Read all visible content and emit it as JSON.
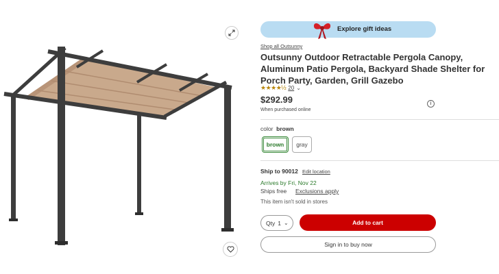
{
  "gallery": {
    "expand_icon": "expand-icon",
    "favorite_icon": "heart-icon",
    "canopy_color": "#c9a98c",
    "frame_color": "#3d3d3d"
  },
  "promo": {
    "label": "Explore gift ideas",
    "icon": "gift-bow-icon",
    "bg_color": "#b9dcf2"
  },
  "product": {
    "shop_all": "Shop all Outsunny",
    "title": "Outsunny Outdoor Retractable Pergola Canopy, Aluminum Patio Pergola, Backyard Shade Shelter for Porch Party, Garden, Grill Gazebo",
    "rating_stars": "★★★★½",
    "rating_count": "20",
    "price": "$292.99",
    "price_note": "When purchased online"
  },
  "variant": {
    "color_label": "color",
    "color_value": "brown",
    "options": [
      "brown",
      "gray"
    ]
  },
  "shipping": {
    "ship_to": "Ship to 90012",
    "edit_location": "Edit location",
    "arrives": "Arrives by Fri, Nov 22",
    "ships_free": "Ships free",
    "exclusions": "Exclusions apply",
    "not_sold": "This item isn't sold in stores"
  },
  "actions": {
    "qty_label": "Qty",
    "qty_value": "1",
    "add_to_cart": "Add to cart",
    "sign_in": "Sign in to buy now",
    "accent_color": "#cc0000"
  }
}
